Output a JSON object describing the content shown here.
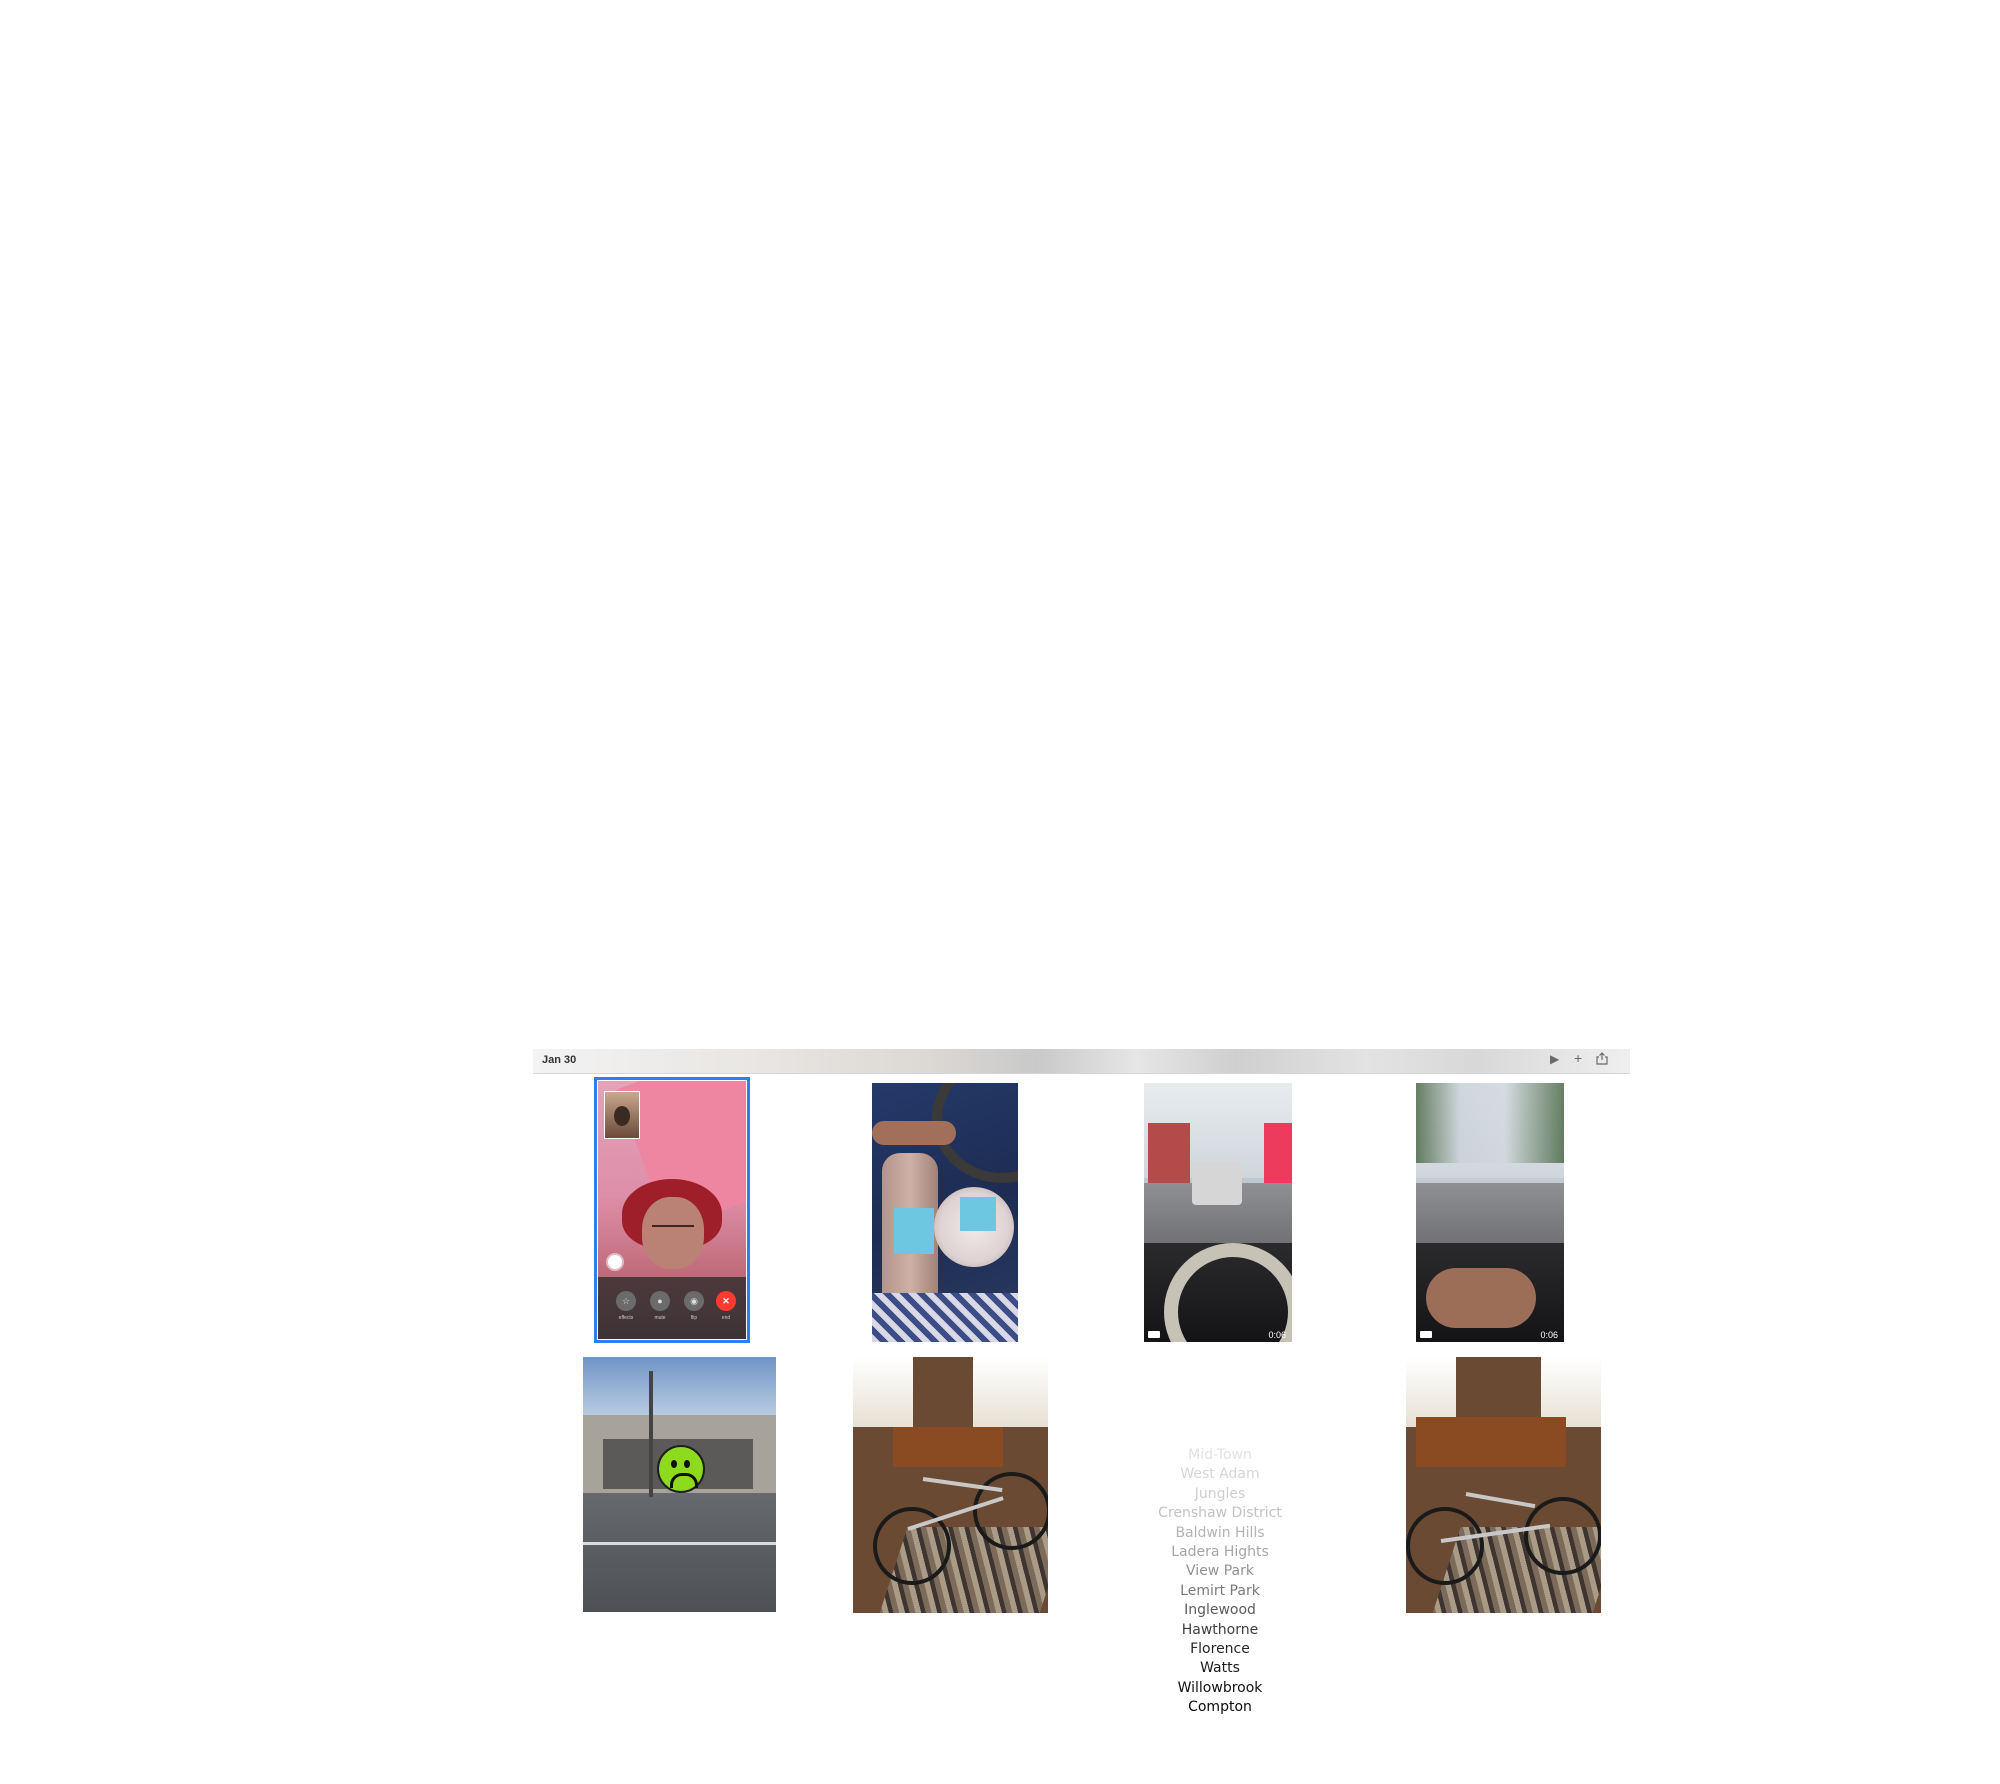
{
  "strip": {
    "date": "Jan 30",
    "controls": {
      "play": "▶",
      "add": "+",
      "share": "share-icon"
    }
  },
  "facetime": {
    "buttons": [
      {
        "icon": "star-icon",
        "glyph": "☆",
        "label": "effects"
      },
      {
        "icon": "mic-icon",
        "glyph": "●",
        "label": "mute"
      },
      {
        "icon": "camera-icon",
        "glyph": "◉",
        "label": "flip"
      },
      {
        "icon": "end-call-icon",
        "glyph": "✕",
        "label": "end"
      }
    ]
  },
  "videos": [
    {
      "duration": "0:06"
    },
    {
      "duration": "0:06"
    }
  ],
  "neighborhoods": [
    {
      "name": "Mid-Town",
      "color": "#e2e2e2"
    },
    {
      "name": "West Adam",
      "color": "#d6d6d6"
    },
    {
      "name": "Jungles",
      "color": "#cecece"
    },
    {
      "name": "Crenshaw District",
      "color": "#c2c2c2"
    },
    {
      "name": "Baldwin Hills",
      "color": "#b4b4b4"
    },
    {
      "name": "Ladera Hights",
      "color": "#a5a5a5"
    },
    {
      "name": "View Park",
      "color": "#929292"
    },
    {
      "name": "Lemirt Park",
      "color": "#7a7a7a"
    },
    {
      "name": "Inglewood",
      "color": "#5c5c5c"
    },
    {
      "name": "Hawthorne",
      "color": "#3e3e3e"
    },
    {
      "name": "Florence",
      "color": "#262626"
    },
    {
      "name": "Watts",
      "color": "#1a1a1a"
    },
    {
      "name": "Willowbrook",
      "color": "#121212"
    },
    {
      "name": "Compton",
      "color": "#0a0a0a"
    }
  ]
}
